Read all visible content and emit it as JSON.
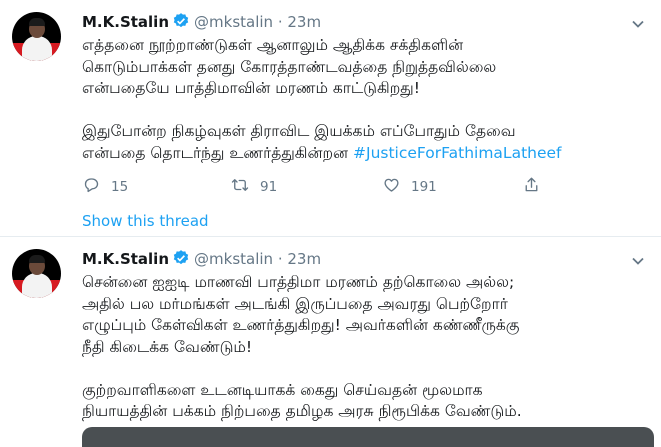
{
  "colors": {
    "accent": "#1da1f2",
    "secondary_text": "#657786",
    "avatar_red": "#d71a21"
  },
  "tweets": [
    {
      "author_name": "M.K.Stalin",
      "handle": "@mkstalin",
      "separator": "·",
      "time": "23m",
      "text_lines": [
        "எத்தனை நூற்றாண்டுகள் ஆனாலும் ஆதிக்க சக்திகளின்",
        "கொடும்பாக்கள் தனது கோரத்தாண்டவத்தை நிறுத்தவில்லை",
        "என்பதையே பாத்திமாவின் மரணம் காட்டுகிறது!",
        "",
        "இதுபோன்ற நிகழ்வுகள் திராவிட இயக்கம் எப்போதும் தேவை"
      ],
      "last_line_prefix": "என்பதை தொடர்ந்து உணர்த்துகின்றன ",
      "hashtag": "#JusticeForFathimaLatheef",
      "replies": "15",
      "retweets": "91",
      "likes": "191"
    },
    {
      "author_name": "M.K.Stalin",
      "handle": "@mkstalin",
      "separator": "·",
      "time": "23m",
      "text": "சென்னை ஐஐடி மாணவி பாத்திமா மரணம் தற்கொலை அல்ல;\nஅதில் பல மர்மங்கள் அடங்கி இருப்பதை அவரது பெற்றோர்\nஎழுப்பும் கேள்விகள் உணர்த்துகிறது! அவர்களின் கண்ணீருக்கு\nநீதி கிடைக்க வேண்டும்!\n\nகுற்றவாளிகளை உடனடியாகக் கைது செய்வதன் மூலமாக\nநியாயத்தின் பக்கம் நிற்பதை தமிழக அரசு நிரூபிக்க வேண்டும்."
    }
  ],
  "show_thread": "Show this thread",
  "icons": [
    "verified-badge-icon",
    "chevron-down-icon",
    "reply-icon",
    "retweet-icon",
    "like-icon",
    "share-icon"
  ]
}
